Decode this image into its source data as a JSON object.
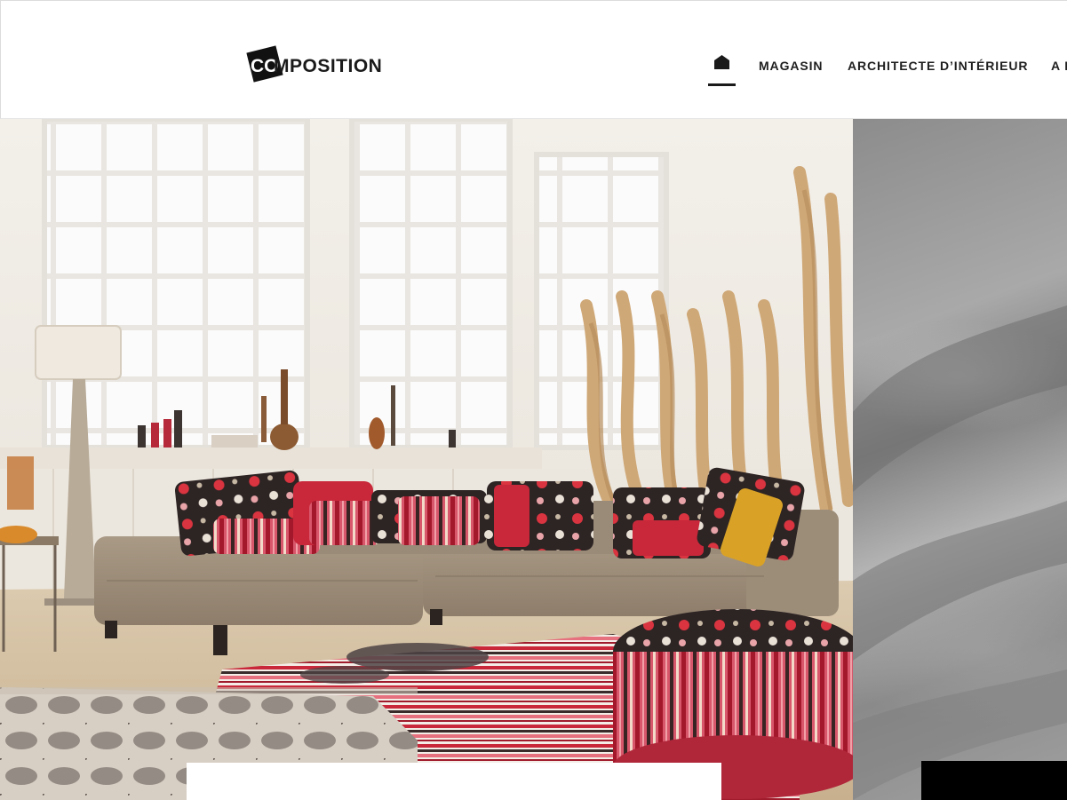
{
  "brand": {
    "logo_co": "CO",
    "logo_rest": "MPOSITION"
  },
  "nav": {
    "home_icon": "home-icon",
    "items": [
      {
        "label": "MAGASIN"
      },
      {
        "label": "ARCHITECTE D’INTÉRIEUR"
      },
      {
        "label": "A P"
      }
    ]
  },
  "colors": {
    "text": "#1f1f1f",
    "header_bg": "#ffffff",
    "active_underline": "#1a1a1a"
  }
}
